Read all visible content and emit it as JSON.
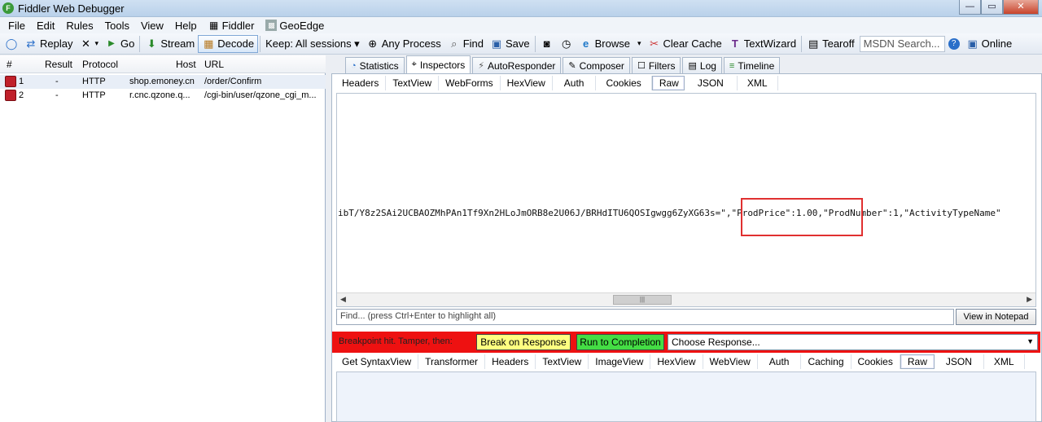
{
  "window": {
    "title": "Fiddler Web Debugger",
    "buttons": {
      "minimize": "—",
      "maximize": "▭",
      "close": "✕"
    }
  },
  "menu": [
    {
      "label": "File"
    },
    {
      "label": "Edit"
    },
    {
      "label": "Rules"
    },
    {
      "label": "Tools"
    },
    {
      "label": "View"
    },
    {
      "label": "Help"
    },
    {
      "label": "Fiddler",
      "icon": "fiddler-script-icon"
    },
    {
      "label": "GeoEdge",
      "icon": "geoedge-icon"
    }
  ],
  "toolbar": {
    "replay": "Replay",
    "remove": "▾",
    "go": "Go",
    "stream": "Stream",
    "decode": "Decode",
    "keep": "Keep: All sessions ▾",
    "any_process": "Any Process",
    "find": "Find",
    "save": "Save",
    "browse": "Browse",
    "browse_dd": "▾",
    "clear_cache": "Clear Cache",
    "textwizard": "TextWizard",
    "tearoff": "Tearoff",
    "search_placeholder": "MSDN Search...",
    "online": "Online"
  },
  "sessions": {
    "columns": {
      "num": "#",
      "result": "Result",
      "protocol": "Protocol",
      "host": "Host",
      "url": "URL"
    },
    "rows": [
      {
        "num": "1",
        "result": "-",
        "protocol": "HTTP",
        "host": "shop.emoney.cn",
        "url": "/order/Confirm"
      },
      {
        "num": "2",
        "result": "-",
        "protocol": "HTTP",
        "host": "r.cnc.qzone.q...",
        "url": "/cgi-bin/user/qzone_cgi_m..."
      }
    ]
  },
  "main_tabs": [
    {
      "label": "Statistics",
      "icon": "statistics-icon"
    },
    {
      "label": "Inspectors",
      "icon": "inspectors-icon"
    },
    {
      "label": "AutoResponder",
      "icon": "lightning-icon"
    },
    {
      "label": "Composer",
      "icon": "composer-icon"
    },
    {
      "label": "Filters",
      "icon": "checkbox-icon"
    },
    {
      "label": "Log",
      "icon": "log-icon"
    },
    {
      "label": "Timeline",
      "icon": "timeline-icon"
    }
  ],
  "request_tabs": [
    "Headers",
    "TextView",
    "WebForms",
    "HexView",
    "Auth",
    "Cookies",
    "Raw",
    "JSON",
    "XML"
  ],
  "request_raw": "ibT/Y8z2SAi2UCBAOZMhPAn1Tf9Xn2HLoJmORB8e2U06J/BRHdITU6QOSIgwgg6ZyXG63s=\",\"ProdPrice\":1.00,\"ProdNumber\":1,\"ActivityTypeName\"",
  "find": {
    "placeholder": "Find... (press Ctrl+Enter to highlight all)",
    "notepad": "View in Notepad"
  },
  "breakpoint": {
    "label": "Breakpoint hit. Tamper, then:",
    "break_on_response": "Break on Response",
    "run_to_completion": "Run to Completion",
    "choose_response": "Choose Response..."
  },
  "response_tabs": [
    "Get SyntaxView",
    "Transformer",
    "Headers",
    "TextView",
    "ImageView",
    "HexView",
    "WebView",
    "Auth",
    "Caching",
    "Cookies",
    "Raw",
    "JSON",
    "XML"
  ]
}
